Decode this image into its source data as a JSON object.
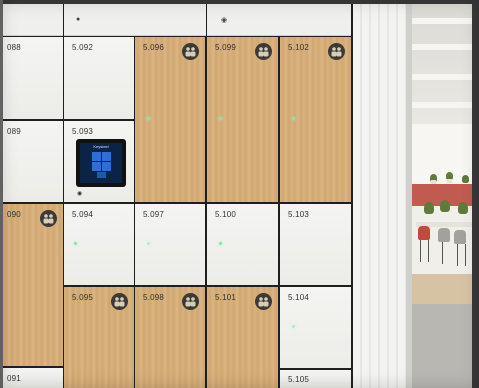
{
  "lockers": {
    "left_column": [
      {
        "id": "l1",
        "label": "088",
        "style": "white"
      },
      {
        "id": "l2",
        "label": "089",
        "style": "white"
      },
      {
        "id": "l3",
        "label": "090",
        "style": "wood"
      },
      {
        "id": "l4",
        "label": "091",
        "style": "white"
      }
    ],
    "doors": [
      {
        "label": "5.092",
        "style": "white"
      },
      {
        "label": "5.093",
        "style": "white"
      },
      {
        "label": "5.094",
        "style": "white"
      },
      {
        "label": "5.095",
        "style": "wood"
      },
      {
        "label": "5.096",
        "style": "wood"
      },
      {
        "label": "5.097",
        "style": "white"
      },
      {
        "label": "5.098",
        "style": "wood"
      },
      {
        "label": "5.099",
        "style": "wood"
      },
      {
        "label": "5.100",
        "style": "white"
      },
      {
        "label": "5.101",
        "style": "wood"
      },
      {
        "label": "5.102",
        "style": "wood"
      },
      {
        "label": "5.103",
        "style": "white"
      },
      {
        "label": "5.104",
        "style": "white"
      },
      {
        "label": "5.105",
        "style": "white"
      }
    ],
    "badge_icon": "people-group-icon",
    "led_color": "#7fe9a8",
    "wood_color": "#d7b07a",
    "white_color": "#f2f2f0"
  },
  "panel": {
    "header": "Keysteel",
    "icon": "touchscreen-panel-icon"
  },
  "scene": {
    "accent_wall_color": "#c25b4f"
  }
}
